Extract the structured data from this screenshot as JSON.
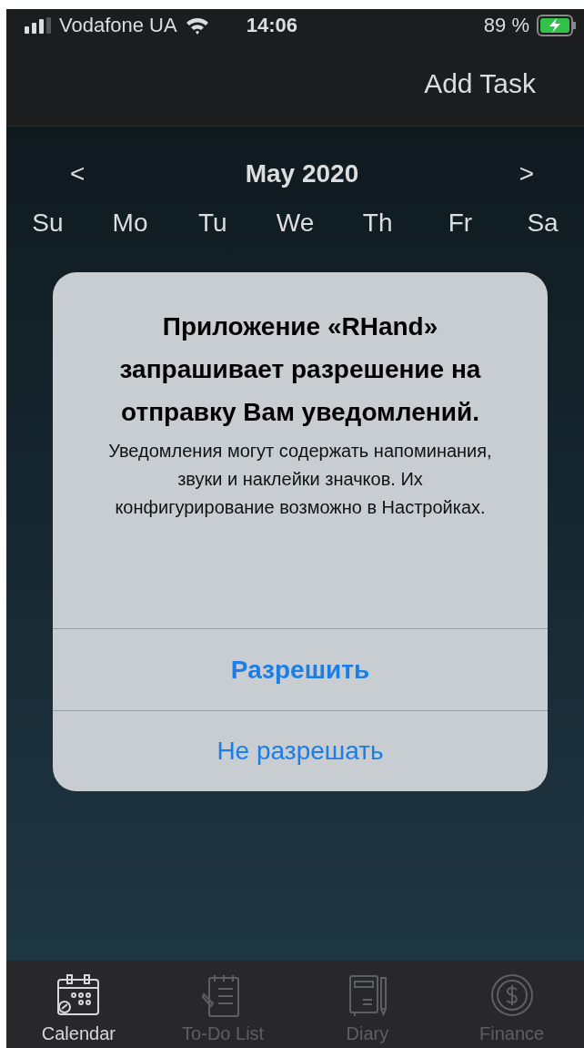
{
  "status_bar": {
    "carrier": "Vodafone UA",
    "time": "14:06",
    "battery": "89 %"
  },
  "nav_bar": {
    "action": "Add Task"
  },
  "calendar": {
    "prev": "<",
    "month": "May 2020",
    "next": ">",
    "weekdays": [
      "Su",
      "Mo",
      "Tu",
      "We",
      "Th",
      "Fr",
      "Sa"
    ]
  },
  "alert": {
    "title": "Приложение «RHand» запрашивает разрешение на отправку Вам уведомлений.",
    "message": "Уведомления могут содержать напоминания, звуки и наклейки значков. Их конфигурирование возможно в Настройках.",
    "buttons": [
      {
        "label": "Разрешить",
        "kind": "preferred"
      },
      {
        "label": "Не разрешать",
        "kind": "normal"
      }
    ]
  },
  "tab_bar": [
    {
      "label": "Calendar",
      "selected": true,
      "kind": "calendar"
    },
    {
      "label": "To-Do List",
      "selected": false,
      "kind": "todo"
    },
    {
      "label": "Diary",
      "selected": false,
      "kind": "diary"
    },
    {
      "label": "Finance",
      "selected": false,
      "kind": "finance"
    }
  ]
}
